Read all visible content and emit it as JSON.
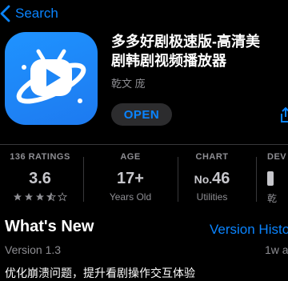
{
  "nav": {
    "back_label": "Search"
  },
  "app": {
    "title_line1": "多多好剧极速版-高清美",
    "title_line2": "剧韩剧视频播放器",
    "developer": "乾文 庞",
    "open_label": "OPEN"
  },
  "stats": {
    "ratings": {
      "header": "136 RATINGS",
      "value": "3.6",
      "stars": 3.6
    },
    "age": {
      "header": "AGE",
      "value": "17+",
      "sub": "Years Old"
    },
    "chart": {
      "header": "CHART",
      "prefix": "No.",
      "value": "46",
      "sub": "Utilities"
    },
    "developer": {
      "header": "DEV",
      "sub": "乾"
    }
  },
  "whats_new": {
    "title": "What's New",
    "history_link": "Version Histo",
    "version": "Version 1.3",
    "ago": "1w a",
    "notes": "优化崩溃问题，提升看剧操作交互体验"
  },
  "colors": {
    "accent": "#0a84ff",
    "icon_bg": "#1d86f6"
  }
}
